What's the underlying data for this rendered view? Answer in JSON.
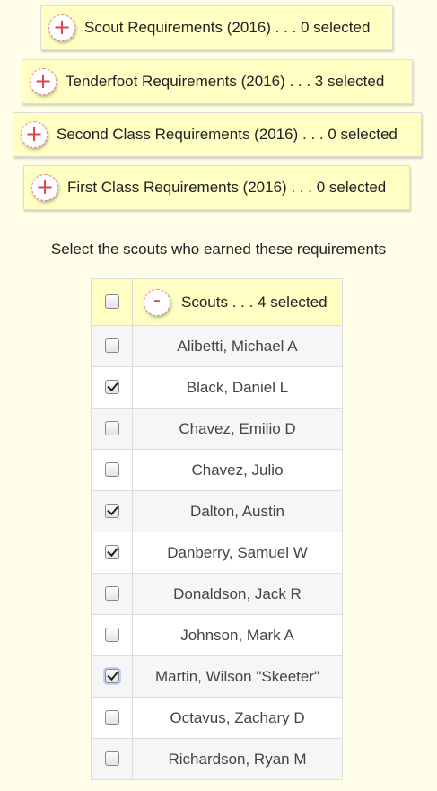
{
  "requirement_groups": [
    {
      "label": "Scout Requirements (2016) . . . 0 selected",
      "button": "+"
    },
    {
      "label": "Tenderfoot Requirements (2016) . . . 3 selected",
      "button": "+"
    },
    {
      "label": "Second Class Requirements (2016) . . . 0 selected",
      "button": "+"
    },
    {
      "label": "First Class Requirements (2016) . . . 0 selected",
      "button": "+"
    }
  ],
  "prompt": "Select the scouts who earned these requirements",
  "scouts_header": {
    "label": "Scouts . . . 4 selected",
    "button": "-"
  },
  "scouts": [
    {
      "name": "Alibetti, Michael A",
      "checked": false
    },
    {
      "name": "Black, Daniel L",
      "checked": true
    },
    {
      "name": "Chavez, Emilio D",
      "checked": false
    },
    {
      "name": "Chavez, Julio",
      "checked": false
    },
    {
      "name": "Dalton, Austin",
      "checked": true
    },
    {
      "name": "Danberry, Samuel W",
      "checked": true
    },
    {
      "name": "Donaldson, Jack R",
      "checked": false
    },
    {
      "name": "Johnson, Mark A",
      "checked": false
    },
    {
      "name": "Martin, Wilson \"Skeeter\"",
      "checked": true
    },
    {
      "name": "Octavus, Zachary D",
      "checked": false
    },
    {
      "name": "Richardson, Ryan M",
      "checked": false
    }
  ]
}
